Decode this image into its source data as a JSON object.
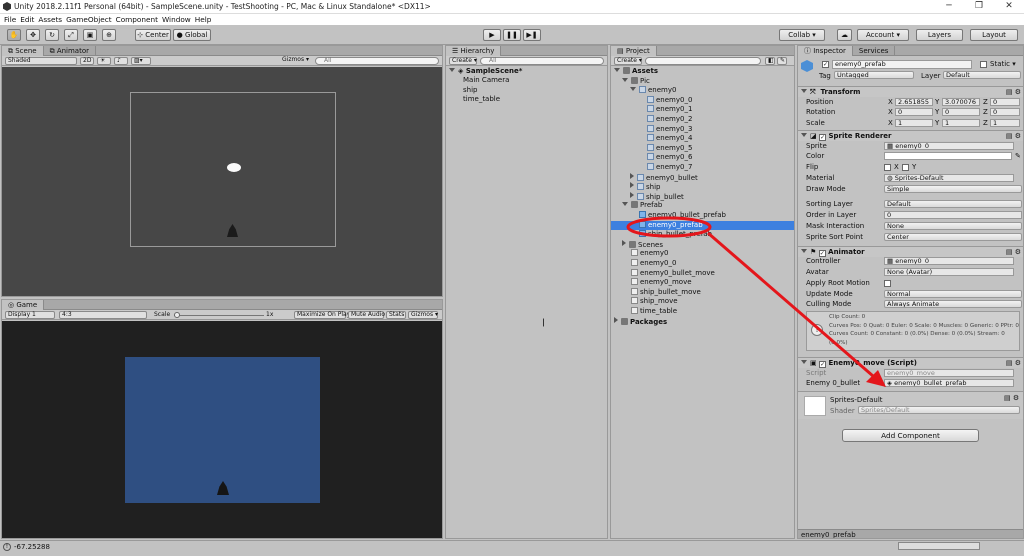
{
  "window": {
    "title": "Unity 2018.2.11f1 Personal (64bit) - SampleScene.unity - TestShooting - PC, Mac & Linux Standalone* <DX11>",
    "minimize": "─",
    "maximize": "❐",
    "close": "✕"
  },
  "menu": [
    "File",
    "Edit",
    "Assets",
    "GameObject",
    "Component",
    "Window",
    "Help"
  ],
  "toolbar": {
    "pivot": "Center",
    "space": "Global",
    "collab": "Collab ▾",
    "account": "Account ▾",
    "layers": "Layers",
    "layout": "Layout"
  },
  "scene": {
    "tabs": [
      "Scene",
      "Animator"
    ],
    "shading": "Shaded",
    "mode2d": "2D",
    "gizmos": "Gizmos ▾",
    "search_placeholder": "All"
  },
  "game": {
    "tab": "Game",
    "display": "Display 1",
    "aspect": "4:3",
    "scale_label": "Scale",
    "scale_value": "1x",
    "buttons": [
      "Maximize On Play",
      "Mute Audio",
      "Stats",
      "Gizmos ▾"
    ],
    "colors": {
      "background": "#202020",
      "camera": "#2f4f82"
    }
  },
  "hierarchy": {
    "tab": "Hierarchy",
    "create": "Create ▾",
    "search_placeholder": "All",
    "scene": "SampleScene*",
    "items": [
      "Main Camera",
      "ship",
      "time_table"
    ]
  },
  "project": {
    "tab": "Project",
    "create": "Create ▾",
    "items": [
      {
        "label": "Assets",
        "indent": 0,
        "icon": "folder",
        "arrow": "down",
        "bold": true
      },
      {
        "label": "Pic",
        "indent": 1,
        "icon": "folder",
        "arrow": "down"
      },
      {
        "label": "enemy0",
        "indent": 2,
        "icon": "sprite",
        "arrow": "down"
      },
      {
        "label": "enemy0_0",
        "indent": 3,
        "icon": "sprite"
      },
      {
        "label": "enemy0_1",
        "indent": 3,
        "icon": "sprite"
      },
      {
        "label": "enemy0_2",
        "indent": 3,
        "icon": "sprite"
      },
      {
        "label": "enemy0_3",
        "indent": 3,
        "icon": "sprite"
      },
      {
        "label": "enemy0_4",
        "indent": 3,
        "icon": "sprite"
      },
      {
        "label": "enemy0_5",
        "indent": 3,
        "icon": "sprite"
      },
      {
        "label": "enemy0_6",
        "indent": 3,
        "icon": "sprite"
      },
      {
        "label": "enemy0_7",
        "indent": 3,
        "icon": "sprite"
      },
      {
        "label": "enemy0_bullet",
        "indent": 2,
        "icon": "sprite",
        "arrow": "right"
      },
      {
        "label": "ship",
        "indent": 2,
        "icon": "sprite",
        "arrow": "right"
      },
      {
        "label": "ship_bullet",
        "indent": 2,
        "icon": "sprite",
        "arrow": "right"
      },
      {
        "label": "Prefab",
        "indent": 1,
        "icon": "folder",
        "arrow": "down"
      },
      {
        "label": "enemy0_bullet_prefab",
        "indent": 2,
        "icon": "prefab"
      },
      {
        "label": "enemy0_prefab",
        "indent": 2,
        "icon": "prefab",
        "selected": true
      },
      {
        "label": "ship_bullet_prefab",
        "indent": 2,
        "icon": "prefab"
      },
      {
        "label": "Scenes",
        "indent": 1,
        "icon": "folder",
        "arrow": "right"
      },
      {
        "label": "enemy0",
        "indent": 1,
        "icon": "anim"
      },
      {
        "label": "enemy0_0",
        "indent": 1,
        "icon": "anim"
      },
      {
        "label": "enemy0_bullet_move",
        "indent": 1,
        "icon": "script"
      },
      {
        "label": "enemy0_move",
        "indent": 1,
        "icon": "script"
      },
      {
        "label": "ship_bullet_move",
        "indent": 1,
        "icon": "script"
      },
      {
        "label": "ship_move",
        "indent": 1,
        "icon": "script"
      },
      {
        "label": "time_table",
        "indent": 1,
        "icon": "script"
      },
      {
        "label": "Packages",
        "indent": 0,
        "icon": "folder",
        "arrow": "right",
        "bold": true
      }
    ]
  },
  "inspector": {
    "tabs": [
      "Inspector",
      "Services"
    ],
    "object_name": "enemy0_prefab",
    "static": "Static ▾",
    "tag_label": "Tag",
    "tag": "Untagged",
    "layer_label": "Layer",
    "layer": "Default",
    "transform": {
      "title": "Transform",
      "position_label": "Position",
      "rotation_label": "Rotation",
      "scale_label": "Scale",
      "position": [
        "2.651855",
        "3.070076",
        "0"
      ],
      "rotation": [
        "0",
        "0",
        "0"
      ],
      "scale": [
        "1",
        "1",
        "1"
      ]
    },
    "sprite_renderer": {
      "title": "Sprite Renderer",
      "sprite_label": "Sprite",
      "sprite": "enemy0_0",
      "color_label": "Color",
      "flip_label": "Flip",
      "flip_x": "X",
      "flip_y": "Y",
      "material_label": "Material",
      "material": "Sprites-Default",
      "draw_mode_label": "Draw Mode",
      "draw_mode": "Simple",
      "sorting_layer_label": "Sorting Layer",
      "sorting_layer": "Default",
      "order_label": "Order in Layer",
      "order": "0",
      "mask_label": "Mask Interaction",
      "mask": "None",
      "sort_point_label": "Sprite Sort Point",
      "sort_point": "Center"
    },
    "animator": {
      "title": "Animator",
      "controller_label": "Controller",
      "controller": "enemy0_0",
      "avatar_label": "Avatar",
      "avatar": "None (Avatar)",
      "root_motion_label": "Apply Root Motion",
      "update_mode_label": "Update Mode",
      "update_mode": "Normal",
      "culling_label": "Culling Mode",
      "culling": "Always Animate",
      "info": "Clip Count: 0\nCurves Pos: 0 Quat: 0 Euler: 0 Scale: 0 Muscles: 0 Generic: 0 PPtr: 0\nCurves Count: 0 Constant: 0 (0.0%) Dense: 0 (0.0%) Stream: 0 (0.0%)"
    },
    "script": {
      "title": "Enemy0_move (Script)",
      "script_label": "Script",
      "script": "enemy0_move",
      "bullet_label": "Enemy 0_bullet",
      "bullet": "enemy0_bullet_prefab"
    },
    "material": {
      "name": "Sprites-Default",
      "shader_label": "Shader",
      "shader": "Sprites/Default"
    },
    "add_component": "Add Component",
    "footer": "enemy0_prefab"
  },
  "status": {
    "text": "-67.25288"
  },
  "colors": {
    "selection": "#3d80df",
    "annotation": "#e4161b"
  }
}
